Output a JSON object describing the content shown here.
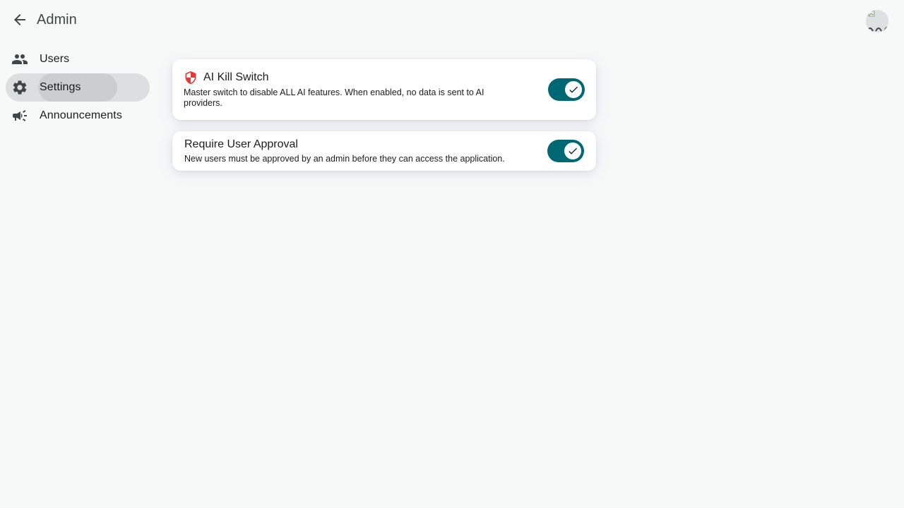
{
  "header": {
    "title": "Admin",
    "avatar_alt": "User avatar"
  },
  "sidebar": {
    "items": [
      {
        "label": "Users",
        "icon": "people-icon"
      },
      {
        "label": "Settings",
        "icon": "gear-icon",
        "active": true
      },
      {
        "label": "Announcements",
        "icon": "megaphone-icon"
      }
    ]
  },
  "settings": {
    "ai_kill_switch": {
      "title": "AI Kill Switch",
      "description": "Master switch to disable ALL AI features. When enabled, no data is sent to AI providers.",
      "enabled": true,
      "icon": "shield-icon"
    },
    "require_user_approval": {
      "title": "Require User Approval",
      "description": "New users must be approved by an admin before they can access the application.",
      "enabled": true
    }
  },
  "colors": {
    "background": "#f7f9f9",
    "toggle_on": "#006874",
    "active_nav": "#dcdedf",
    "shield_red": "#e53935"
  }
}
